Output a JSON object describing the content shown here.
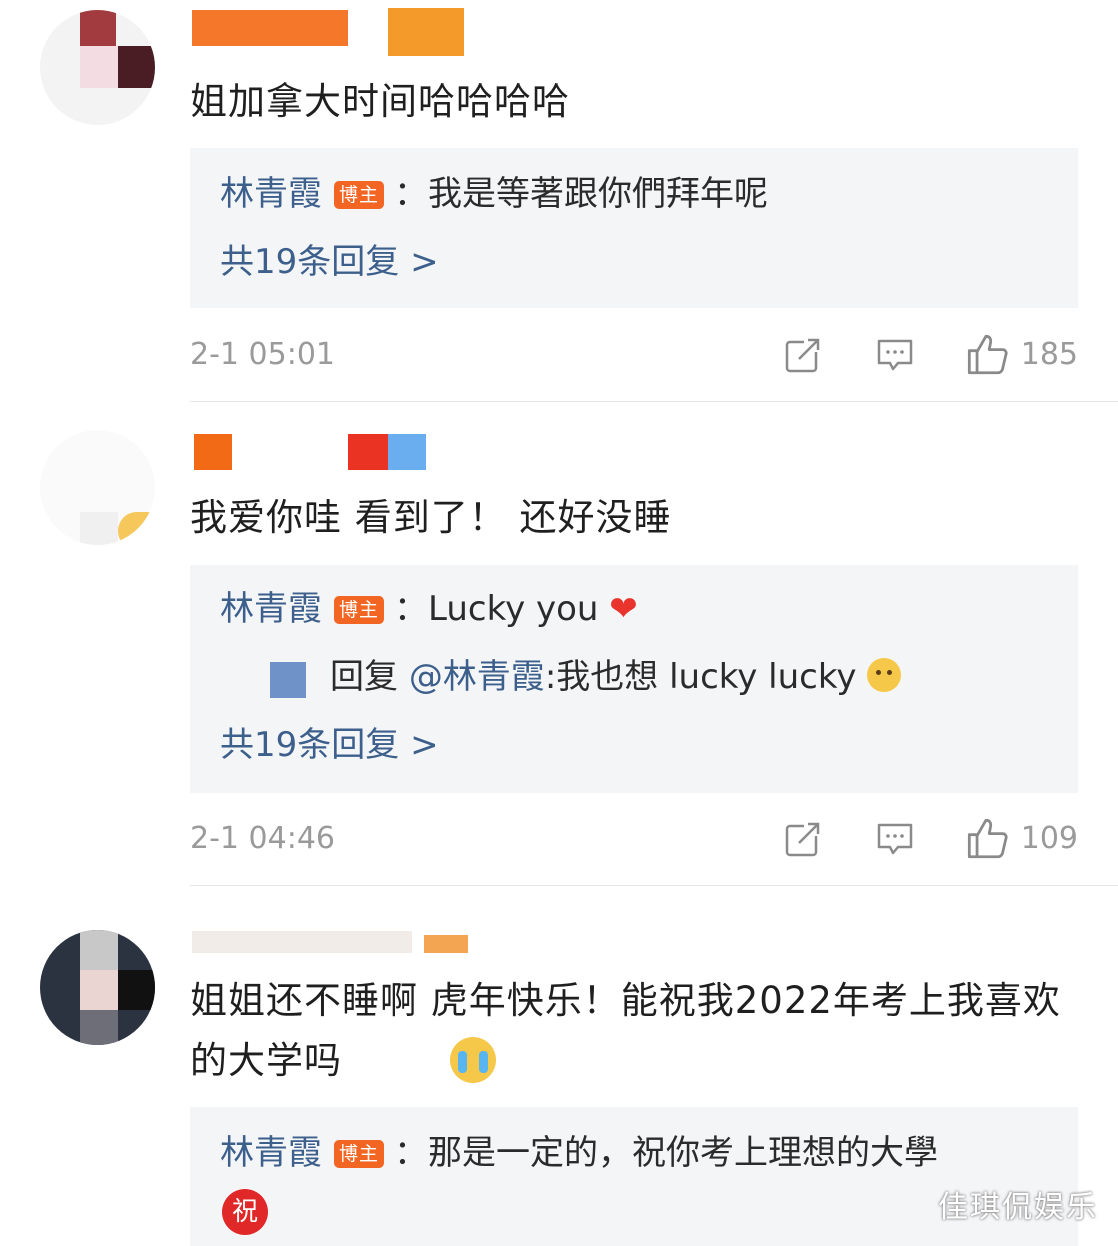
{
  "comments": [
    {
      "text": "姐加拿大时间哈哈哈哈",
      "reply": {
        "author": "林青霞",
        "badge": "博主",
        "text": "：我是等著跟你們拜年呢"
      },
      "more_replies": "共19条回复 >",
      "time": "2-1 05:01",
      "likes": "185"
    },
    {
      "text": "我爱你哇 看到了！ 还好没睡",
      "reply": {
        "author": "林青霞",
        "badge": "博主",
        "text": "：Lucky you"
      },
      "sub_reply": {
        "prefix": "回复",
        "mention": "@林青霞",
        "text": ":我也想 lucky lucky"
      },
      "more_replies": "共19条回复 >",
      "time": "2-1 04:46",
      "likes": "109"
    },
    {
      "text": "姐姐还不睡啊 虎年快乐！能祝我2022年考上我喜欢的大学吗",
      "reply": {
        "author": "林青霞",
        "badge": "博主",
        "text": "：那是一定的，祝你考上理想的大學"
      },
      "reply_emoji": "祝"
    }
  ],
  "icons": {
    "share": "share-icon",
    "comment": "comment-icon",
    "like": "thumbs-up-icon",
    "heart": "heart-emoji",
    "cry": "crying-emoji"
  },
  "colors": {
    "name_blue": "#3c5f8c",
    "badge_orange": "#f26522",
    "meta_gray": "#9a9a9a",
    "reply_bg": "#f4f5f7"
  },
  "watermark": "佳琪侃娱乐"
}
